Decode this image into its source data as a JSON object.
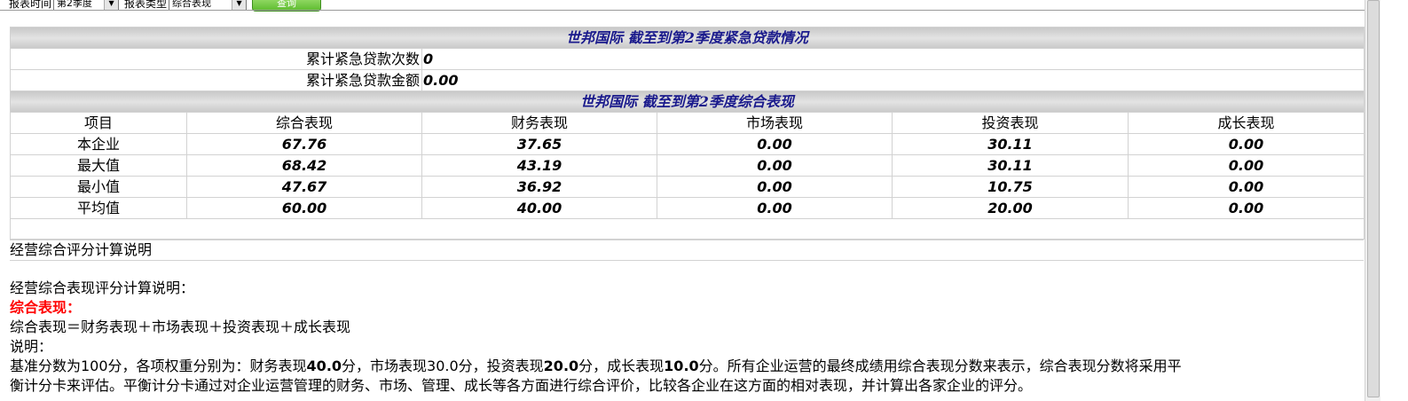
{
  "filter_bar": {
    "time_label": "报表时间",
    "time_value": "第2季度",
    "type_label": "报表类型",
    "type_value": "综合表现",
    "query_label": "查询"
  },
  "emergency": {
    "title": "世邦国际 截至到第2季度紧急贷款情况",
    "rows": [
      {
        "label": "累计紧急贷款次数",
        "value": "0"
      },
      {
        "label": "累计紧急贷款金额",
        "value": "0.00"
      }
    ]
  },
  "overall": {
    "title": "世邦国际 截至到第2季度综合表现",
    "columns": [
      "项目",
      "综合表现",
      "财务表现",
      "市场表现",
      "投资表现",
      "成长表现"
    ],
    "rows": [
      {
        "name": "本企业",
        "values": [
          "67.76",
          "37.65",
          "0.00",
          "30.11",
          "0.00"
        ]
      },
      {
        "name": "最大值",
        "values": [
          "68.42",
          "43.19",
          "0.00",
          "30.11",
          "0.00"
        ]
      },
      {
        "name": "最小值",
        "values": [
          "47.67",
          "36.92",
          "0.00",
          "10.75",
          "0.00"
        ]
      },
      {
        "name": "平均值",
        "values": [
          "60.00",
          "40.00",
          "0.00",
          "20.00",
          "0.00"
        ]
      }
    ]
  },
  "explanation": {
    "section_title": "经营综合评分计算说明",
    "heading": "经营综合表现评分计算说明：",
    "term": "综合表现",
    "term_colon": "：",
    "formula": "综合表现＝财务表现＋市场表现＋投资表现＋成长表现",
    "note_label": "说明：",
    "para_1": "基准分数为100分，各项权重分别为：财务表现",
    "w_fin": "40.0",
    "para_2": "分，市场表现30.0分，投资表现",
    "w_inv": "20.0",
    "para_3": "分，成长表现",
    "w_grow": "10.0",
    "para_4": "分。所有企业运营的最终成绩用综合表现分数来表示，综合表现分数将采用平",
    "line2": "衡计分卡来评估。平衡计分卡通过对企业运营管理的财务、市场、管理、成长等各方面进行综合评价，比较各企业在这方面的相对表现，并计算出各家企业的评分。"
  },
  "colors": {
    "banner_text": "#1a1a8c",
    "highlight": "#ff0000",
    "button": "#5dbb2e"
  }
}
